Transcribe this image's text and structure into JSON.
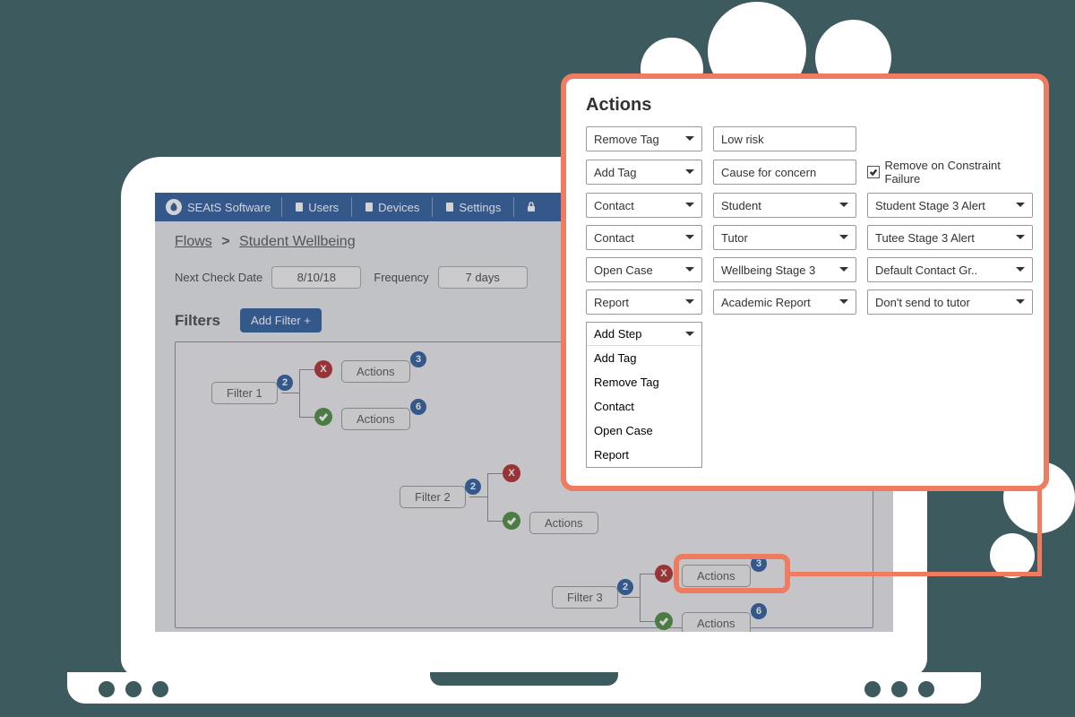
{
  "brand": "SEAtS Software",
  "nav": {
    "users": "Users",
    "devices": "Devices",
    "settings": "Settings"
  },
  "breadcrumb": {
    "root": "Flows",
    "sep": ">",
    "current": "Student Wellbeing"
  },
  "params": {
    "nextCheckLabel": "Next Check Date",
    "nextCheckValue": "8/10/18",
    "frequencyLabel": "Frequency",
    "frequencyValue": "7 days"
  },
  "filtersHeading": "Filters",
  "addFilterLabel": "Add Filter +",
  "flow": {
    "filter1": "Filter 1",
    "filter2": "Filter 2",
    "filter3": "Filter 3",
    "actions": "Actions",
    "b2": "2",
    "b3": "3",
    "b6": "6",
    "x": "X"
  },
  "popover": {
    "title": "Actions",
    "rows": [
      {
        "c1": "Remove Tag",
        "c2": "Low risk",
        "c3": null,
        "c2type": "txt"
      },
      {
        "c1": "Add Tag",
        "c2": "Cause for concern",
        "c3chk": "Remove on Constraint Failure",
        "c2type": "txt"
      },
      {
        "c1": "Contact",
        "c2": "Student",
        "c3": "Student Stage 3 Alert"
      },
      {
        "c1": "Contact",
        "c2": "Tutor",
        "c3": "Tutee Stage 3 Alert"
      },
      {
        "c1": "Open Case",
        "c2": "Wellbeing Stage 3",
        "c3": "Default Contact Gr.."
      },
      {
        "c1": "Report",
        "c2": "Academic Report",
        "c3": "Don't send to tutor"
      }
    ],
    "addStep": "Add Step",
    "menu": [
      "Add Tag",
      "Remove Tag",
      "Contact",
      "Open Case",
      "Report"
    ]
  }
}
